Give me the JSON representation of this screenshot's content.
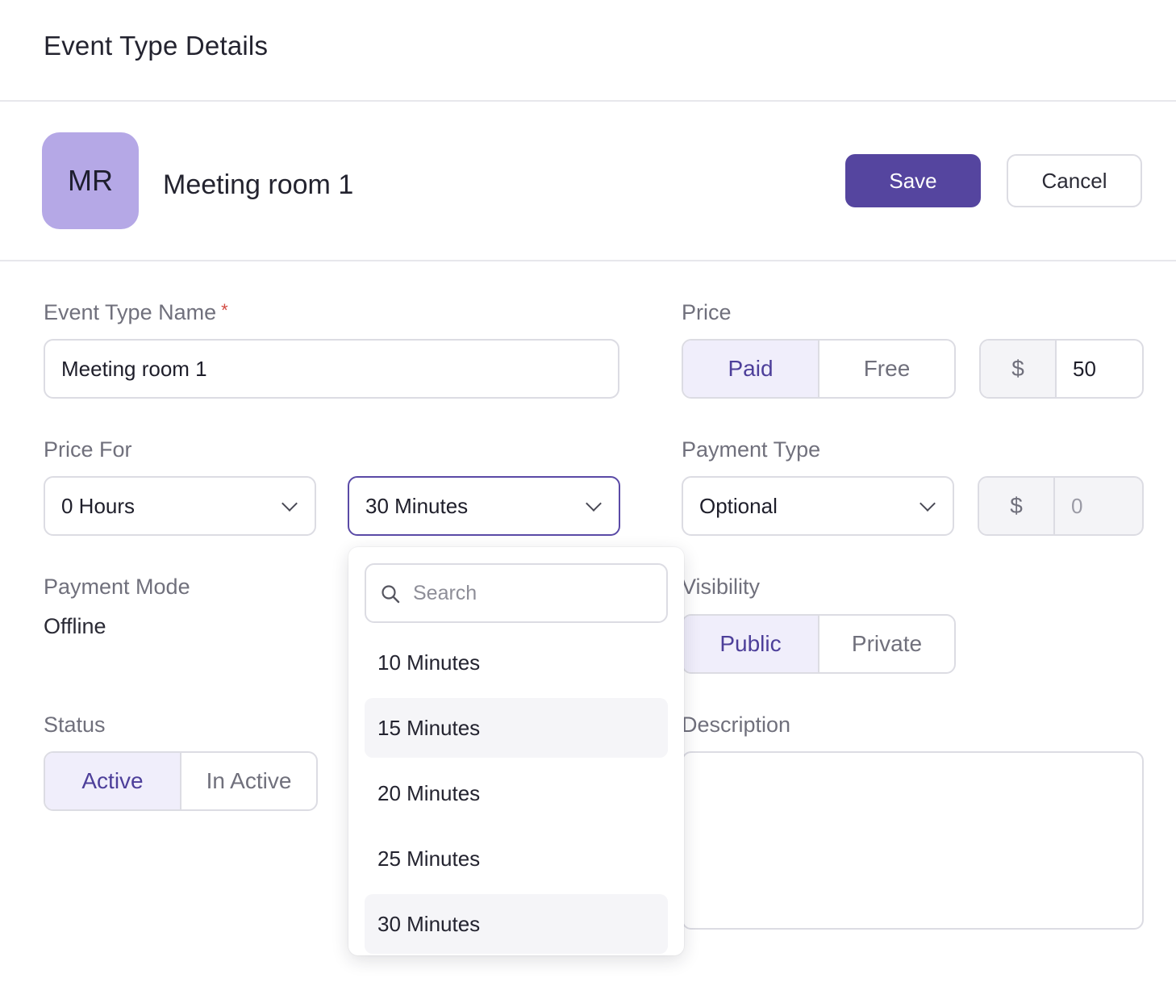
{
  "header": {
    "title": "Event Type Details"
  },
  "entity": {
    "initials": "MR",
    "name": "Meeting room 1"
  },
  "actions": {
    "save_label": "Save",
    "cancel_label": "Cancel"
  },
  "form": {
    "event_type_name": {
      "label": "Event Type Name",
      "required_mark": "*",
      "value": "Meeting room 1"
    },
    "price": {
      "label": "Price",
      "options": [
        "Paid",
        "Free"
      ],
      "selected": "Paid",
      "currency": "$",
      "amount": "50"
    },
    "price_for": {
      "label": "Price For",
      "hours_value": "0 Hours",
      "minutes_value": "30 Minutes"
    },
    "payment_type": {
      "label": "Payment Type",
      "value": "Optional",
      "currency": "$",
      "amount": "0"
    },
    "payment_mode": {
      "label": "Payment Mode",
      "value": "Offline"
    },
    "visibility": {
      "label": "Visibility",
      "options": [
        "Public",
        "Private"
      ],
      "selected": "Public"
    },
    "status": {
      "label": "Status",
      "options": [
        "Active",
        "In Active"
      ],
      "selected": "Active"
    },
    "description": {
      "label": "Description",
      "value": ""
    }
  },
  "minutes_dropdown": {
    "search_placeholder": "Search",
    "options": [
      "10 Minutes",
      "15 Minutes",
      "20 Minutes",
      "25 Minutes",
      "30 Minutes"
    ],
    "hovered": "15 Minutes",
    "selected": "30 Minutes"
  },
  "colors": {
    "primary": "#55459f",
    "avatar_bg": "#b5a8e6",
    "segment_active_bg": "#f0eefb",
    "segment_active_text": "#4d3f9a",
    "required": "#d24b43"
  }
}
